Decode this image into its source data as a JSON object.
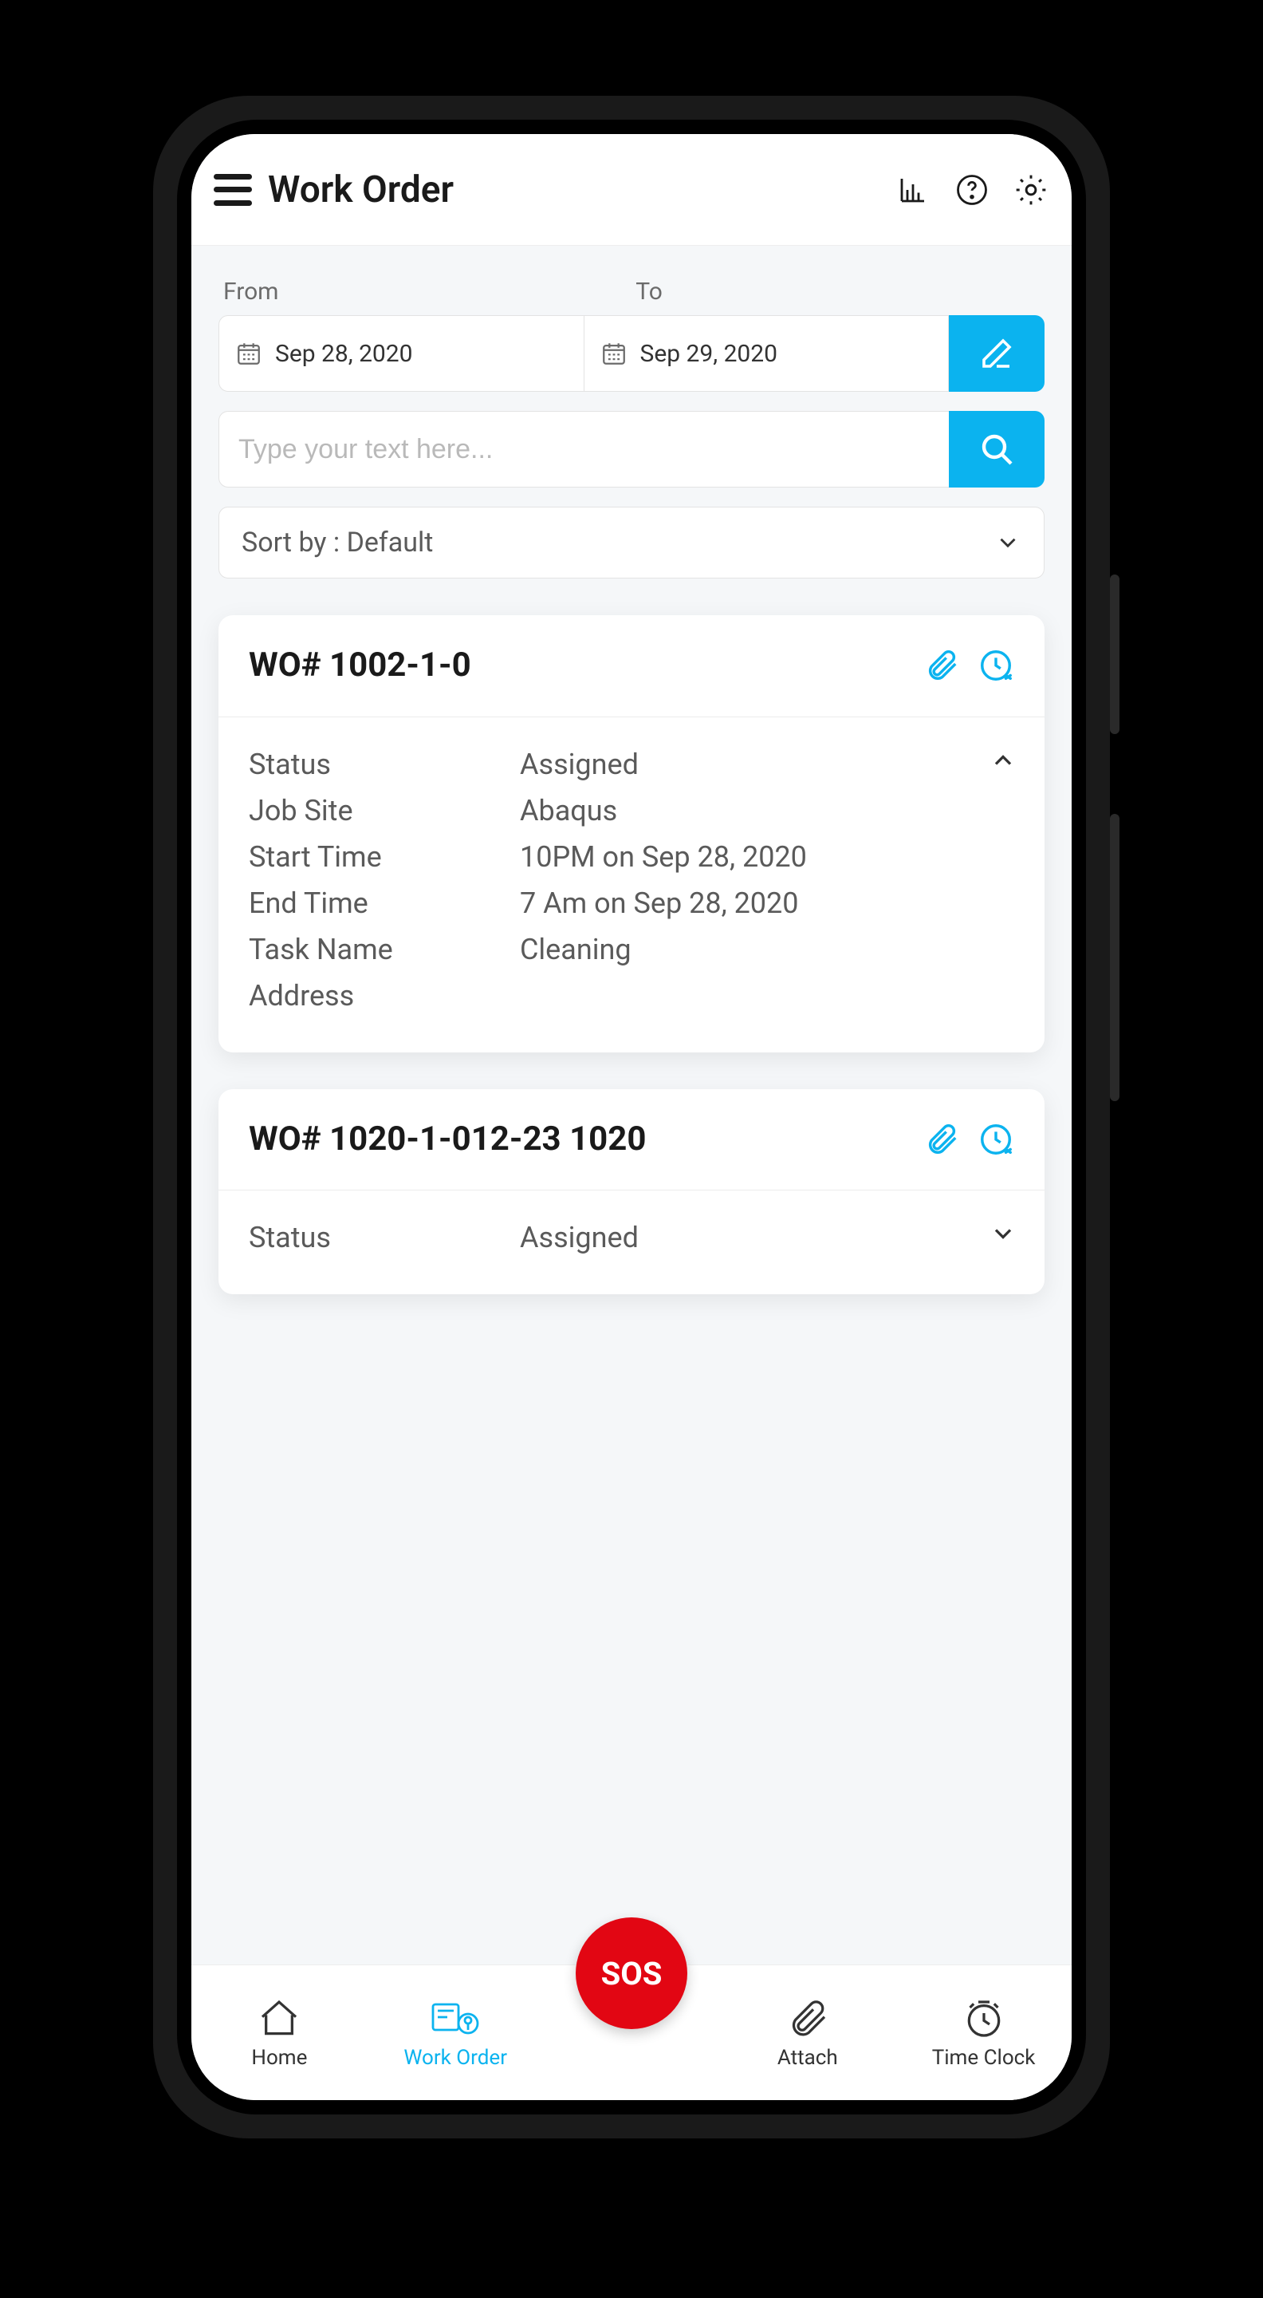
{
  "header": {
    "title": "Work Order"
  },
  "filter": {
    "from_label": "From",
    "to_label": "To",
    "from_date": "Sep 28, 2020",
    "to_date": "Sep 29, 2020",
    "search_placeholder": "Type your text here...",
    "sort_label": "Sort by : Default"
  },
  "cards": [
    {
      "title": "WO# 1002-1-0",
      "expanded": true,
      "rows": [
        {
          "k": "Status",
          "v": "Assigned"
        },
        {
          "k": "Job Site",
          "v": "Abaqus"
        },
        {
          "k": "Start Time",
          "v": "10PM on Sep 28, 2020"
        },
        {
          "k": "End Time",
          "v": "7 Am on Sep 28, 2020"
        },
        {
          "k": "Task Name",
          "v": "Cleaning"
        },
        {
          "k": "Address",
          "v": ""
        }
      ]
    },
    {
      "title": "WO# 1020-1-012-23 1020",
      "expanded": false,
      "rows": [
        {
          "k": "Status",
          "v": "Assigned"
        }
      ]
    }
  ],
  "sos_label": "SOS",
  "nav": [
    {
      "label": "Home",
      "active": false
    },
    {
      "label": "Work Order",
      "active": true
    },
    {
      "label": "Attach",
      "active": false
    },
    {
      "label": "Time Clock",
      "active": false
    }
  ],
  "colors": {
    "accent": "#0bb3ef",
    "danger": "#e20613"
  }
}
